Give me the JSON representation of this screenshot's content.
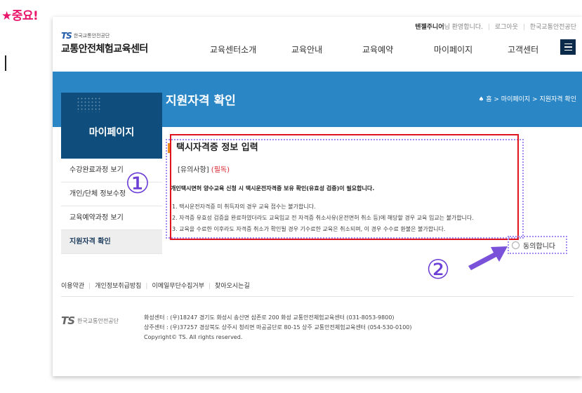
{
  "note": {
    "text": "★중요!"
  },
  "header": {
    "user_name": "텐젤주니어",
    "welcome_suffix": "님 환영합니다.",
    "logout": "로그아웃",
    "org_link": "한국교통안전공단",
    "logo_mark": "TS",
    "logo_sub": "한국교통안전공단",
    "logo_main": "교통안전체험교육센터"
  },
  "nav": {
    "items": [
      "교육센터소개",
      "교육안내",
      "교육예약",
      "마이페이지",
      "고객센터"
    ]
  },
  "banner": {
    "title": "지원자격 확인",
    "breadcrumb": "♠ 홈 > 마이페이지 > 지원자격 확인"
  },
  "sidebar": {
    "title": "마이페이지",
    "items": [
      "수강완료과정 보기",
      "개인/단체 정보수정",
      "교육예약과정 보기",
      "지원자격 확인"
    ]
  },
  "content": {
    "title": "택시자격증 정보 입력",
    "notice_head": "[유의사항]",
    "notice_required": "(필독)",
    "notice_main": "개인택시면허 양수교육 신청 시 택시운전자격증 보유 확인(유효성 검증)이 필요합니다.",
    "notice_lines": [
      "1. 택시운전자격증 미 취득자의 경우 교육 접수는 불가합니다.",
      "2. 자격증 유효성 검증을 완료하였더라도 교육입교 전 자격증 취소사유(운전면허 취소 등)에 해당할 경우 교육 입교는 불가합니다.",
      "3. 교육을 수료한 이후라도 자격증 취소가 확인될 경우 기수료한 교육은 취소되며, 이 경우 수수료 환불은 불가합니다."
    ],
    "agree_label": "동의합니다"
  },
  "annotations": {
    "num1": "①",
    "num2": "②"
  },
  "footer": {
    "links": [
      "이용약관",
      "개인정보취급방침",
      "이메일무단수집거부",
      "찾아오시는길"
    ],
    "logo_mark": "TS",
    "logo_text": "한국교통안전공단",
    "lines": [
      "화성센터 : (우)18247 경기도 화성시 송산면 삼존로 200 화성 교통안전체험교육센터 (031-8053-9800)",
      "상주센터 : (우)37257 경상북도 상주시 청리면 마공공단로 80-15 상주 교통안전체험교육센터 (054-530-0100)",
      "Copyright© TS. All rights reserved."
    ]
  },
  "colors": {
    "accent": "#2a86c5",
    "sidebar_head": "#0f4e7c",
    "highlight_red": "#e0141e",
    "annotation_purple": "#6c3fd6"
  }
}
